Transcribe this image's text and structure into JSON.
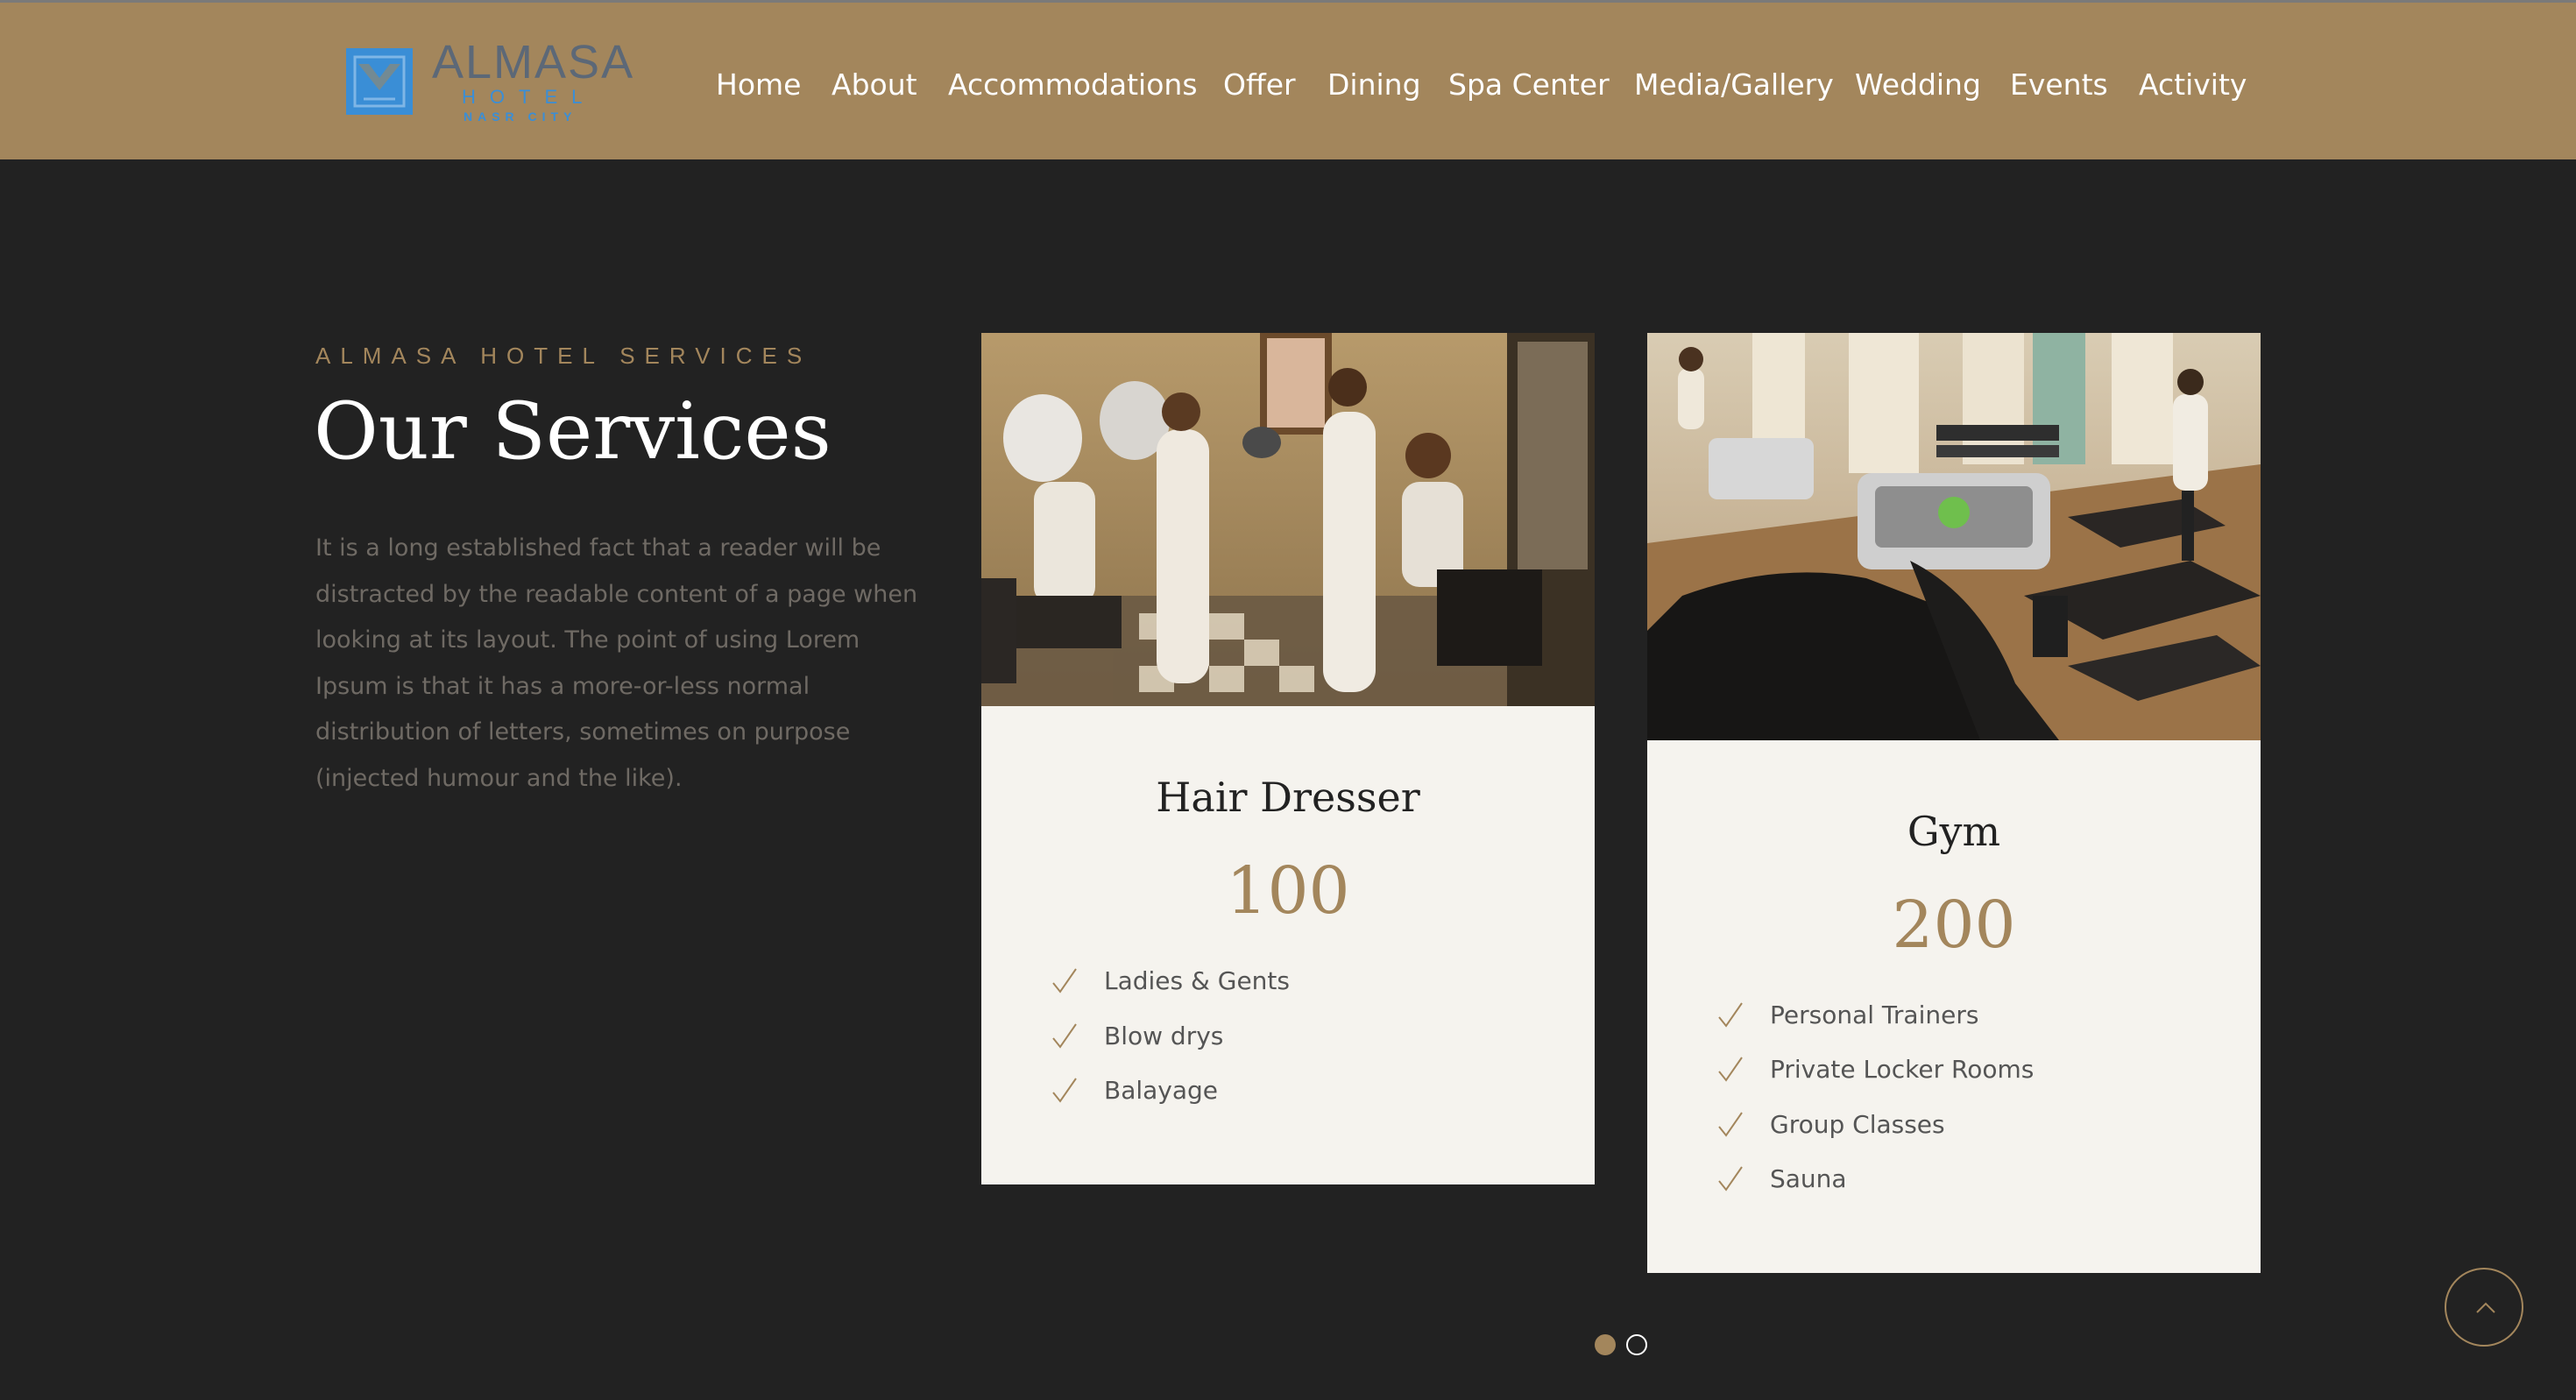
{
  "brand": {
    "name": "ALMASA",
    "sub": "HOTEL",
    "tagline": "NASR CITY",
    "colors": {
      "gold": "#a3865c",
      "logo_blue": "#3a8ed6",
      "logo_gray": "#5c6877",
      "background": "#222222",
      "card": "#f5f3ee"
    }
  },
  "nav": {
    "items": [
      {
        "label": "Home"
      },
      {
        "label": "About"
      },
      {
        "label": "Accommodations"
      },
      {
        "label": "Offer"
      },
      {
        "label": "Dining"
      },
      {
        "label": "Spa Center"
      },
      {
        "label": "Media/Gallery"
      },
      {
        "label": "Wedding"
      },
      {
        "label": "Events"
      },
      {
        "label": "Activity"
      }
    ]
  },
  "intro": {
    "eyebrow": "ALMASA HOTEL SERVICES",
    "title": "Our Services",
    "description": "It is a long established fact that a reader will be distracted by the readable content of a page when looking at its layout. The point of using Lorem Ipsum is that it has a more-or-less normal distribution of letters, sometimes on purpose (injected humour and the like)."
  },
  "services": [
    {
      "title": "Hair Dresser",
      "price": "100",
      "image_icon": "hair-salon-photo",
      "features": [
        "Ladies & Gents",
        "Blow drys",
        "Balayage"
      ]
    },
    {
      "title": "Gym",
      "price": "200",
      "image_icon": "gym-treadmill-photo",
      "features": [
        "Personal Trainers",
        "Private Locker Rooms",
        "Group Classes",
        "Sauna"
      ]
    }
  ],
  "carousel": {
    "active_index": 1,
    "total": 2
  },
  "controls": {
    "back_to_top_icon": "chevron-up-icon",
    "check_icon": "check-icon"
  }
}
